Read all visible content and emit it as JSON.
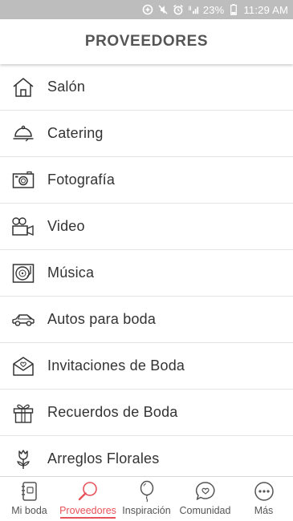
{
  "status_bar": {
    "battery": "23%",
    "time": "11:29 AM"
  },
  "header": {
    "title": "PROVEEDORES"
  },
  "categories": [
    {
      "label": "Salón",
      "icon": "house-icon"
    },
    {
      "label": "Catering",
      "icon": "cloche-icon"
    },
    {
      "label": "Fotografía",
      "icon": "camera-icon"
    },
    {
      "label": "Video",
      "icon": "video-camera-icon"
    },
    {
      "label": "Música",
      "icon": "turntable-icon"
    },
    {
      "label": "Autos para boda",
      "icon": "car-icon"
    },
    {
      "label": "Invitaciones de Boda",
      "icon": "envelope-heart-icon"
    },
    {
      "label": "Recuerdos de Boda",
      "icon": "gift-icon"
    },
    {
      "label": "Arreglos Florales",
      "icon": "tulip-icon"
    }
  ],
  "bottom_nav": [
    {
      "label": "Mi boda",
      "icon": "notebook-icon",
      "active": false
    },
    {
      "label": "Proveedores",
      "icon": "magnifier-icon",
      "active": true
    },
    {
      "label": "Inspiración",
      "icon": "balloon-icon",
      "active": false
    },
    {
      "label": "Comunidad",
      "icon": "chat-heart-icon",
      "active": false
    },
    {
      "label": "Más",
      "icon": "more-dots-icon",
      "active": false
    }
  ],
  "colors": {
    "accent": "#e8525a",
    "status_bar": "#bdbdbd",
    "text": "#333333",
    "divider": "#e4e4e4"
  }
}
